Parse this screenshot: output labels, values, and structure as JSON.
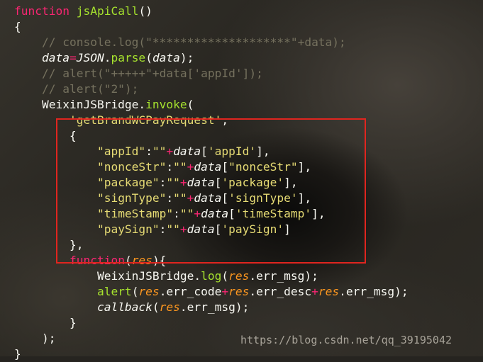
{
  "lines": [
    [
      [
        "kw",
        "function "
      ],
      [
        "fn",
        "jsApiCall"
      ],
      [
        "pl",
        "()"
      ]
    ],
    [
      [
        "pl",
        "{"
      ]
    ],
    [
      [
        "pl",
        "    "
      ],
      [
        "cm",
        "// console.log(\"********************\"+data);"
      ]
    ],
    [
      [
        "pl",
        "    "
      ],
      [
        "it",
        "data"
      ],
      [
        "op",
        "="
      ],
      [
        "it",
        "JSON"
      ],
      [
        "pl",
        "."
      ],
      [
        "fn",
        "parse"
      ],
      [
        "pl",
        "("
      ],
      [
        "it",
        "data"
      ],
      [
        "pl",
        ");"
      ]
    ],
    [
      [
        "pl",
        "    "
      ],
      [
        "cm",
        "// alert(\"+++++\"+data['appId']);"
      ]
    ],
    [
      [
        "pl",
        "    "
      ],
      [
        "cm",
        "// alert(\"2\");"
      ]
    ],
    [
      [
        "pl",
        "    WeixinJSBridge."
      ],
      [
        "fn",
        "invoke"
      ],
      [
        "pl",
        "("
      ]
    ],
    [
      [
        "pl",
        "        "
      ],
      [
        "str",
        "'getBrandWCPayRequest'"
      ],
      [
        "pl",
        ","
      ]
    ],
    [
      [
        "pl",
        "        {"
      ]
    ],
    [
      [
        "pl",
        "            "
      ],
      [
        "str",
        "\"appId\""
      ],
      [
        "pl",
        ":"
      ],
      [
        "str",
        "\"\""
      ],
      [
        "op",
        "+"
      ],
      [
        "it",
        "data"
      ],
      [
        "pl",
        "["
      ],
      [
        "str",
        "'appId'"
      ],
      [
        "pl",
        "],"
      ]
    ],
    [
      [
        "pl",
        "            "
      ],
      [
        "str",
        "\"nonceStr\""
      ],
      [
        "pl",
        ":"
      ],
      [
        "str",
        "\"\""
      ],
      [
        "op",
        "+"
      ],
      [
        "it",
        "data"
      ],
      [
        "pl",
        "["
      ],
      [
        "str",
        "\"nonceStr\""
      ],
      [
        "pl",
        "],"
      ]
    ],
    [
      [
        "pl",
        "            "
      ],
      [
        "str",
        "\"package\""
      ],
      [
        "pl",
        ":"
      ],
      [
        "str",
        "\"\""
      ],
      [
        "op",
        "+"
      ],
      [
        "it",
        "data"
      ],
      [
        "pl",
        "["
      ],
      [
        "str",
        "'package'"
      ],
      [
        "pl",
        "],"
      ]
    ],
    [
      [
        "pl",
        "            "
      ],
      [
        "str",
        "\"signType\""
      ],
      [
        "pl",
        ":"
      ],
      [
        "str",
        "\"\""
      ],
      [
        "op",
        "+"
      ],
      [
        "it",
        "data"
      ],
      [
        "pl",
        "["
      ],
      [
        "str",
        "'signType'"
      ],
      [
        "pl",
        "],"
      ]
    ],
    [
      [
        "pl",
        "            "
      ],
      [
        "str",
        "\"timeStamp\""
      ],
      [
        "pl",
        ":"
      ],
      [
        "str",
        "\"\""
      ],
      [
        "op",
        "+"
      ],
      [
        "it",
        "data"
      ],
      [
        "pl",
        "["
      ],
      [
        "str",
        "'timeStamp'"
      ],
      [
        "pl",
        "],"
      ]
    ],
    [
      [
        "pl",
        "            "
      ],
      [
        "str",
        "\"paySign\""
      ],
      [
        "pl",
        ":"
      ],
      [
        "str",
        "\"\""
      ],
      [
        "op",
        "+"
      ],
      [
        "it",
        "data"
      ],
      [
        "pl",
        "["
      ],
      [
        "str",
        "'paySign'"
      ],
      [
        "pl",
        "]"
      ]
    ],
    [
      [
        "pl",
        "        },"
      ]
    ],
    [
      [
        "pl",
        "        "
      ],
      [
        "kw",
        "function"
      ],
      [
        "pl",
        "("
      ],
      [
        "ar",
        "res"
      ],
      [
        "pl",
        "){"
      ]
    ],
    [
      [
        "pl",
        "            WeixinJSBridge."
      ],
      [
        "fn",
        "log"
      ],
      [
        "pl",
        "("
      ],
      [
        "ar",
        "res"
      ],
      [
        "pl",
        ".err_msg);"
      ]
    ],
    [
      [
        "pl",
        "            "
      ],
      [
        "fn",
        "alert"
      ],
      [
        "pl",
        "("
      ],
      [
        "ar",
        "res"
      ],
      [
        "pl",
        ".err_code"
      ],
      [
        "op",
        "+"
      ],
      [
        "ar",
        "res"
      ],
      [
        "pl",
        ".err_desc"
      ],
      [
        "op",
        "+"
      ],
      [
        "ar",
        "res"
      ],
      [
        "pl",
        ".err_msg);"
      ]
    ],
    [
      [
        "pl",
        "            "
      ],
      [
        "it",
        "callback"
      ],
      [
        "pl",
        "("
      ],
      [
        "ar",
        "res"
      ],
      [
        "pl",
        ".err_msg);"
      ]
    ],
    [
      [
        "pl",
        "        }"
      ]
    ],
    [
      [
        "pl",
        "    );"
      ]
    ],
    [
      [
        "pl",
        "}"
      ]
    ]
  ],
  "watermark": "https://blog.csdn.net/qq_39195042"
}
